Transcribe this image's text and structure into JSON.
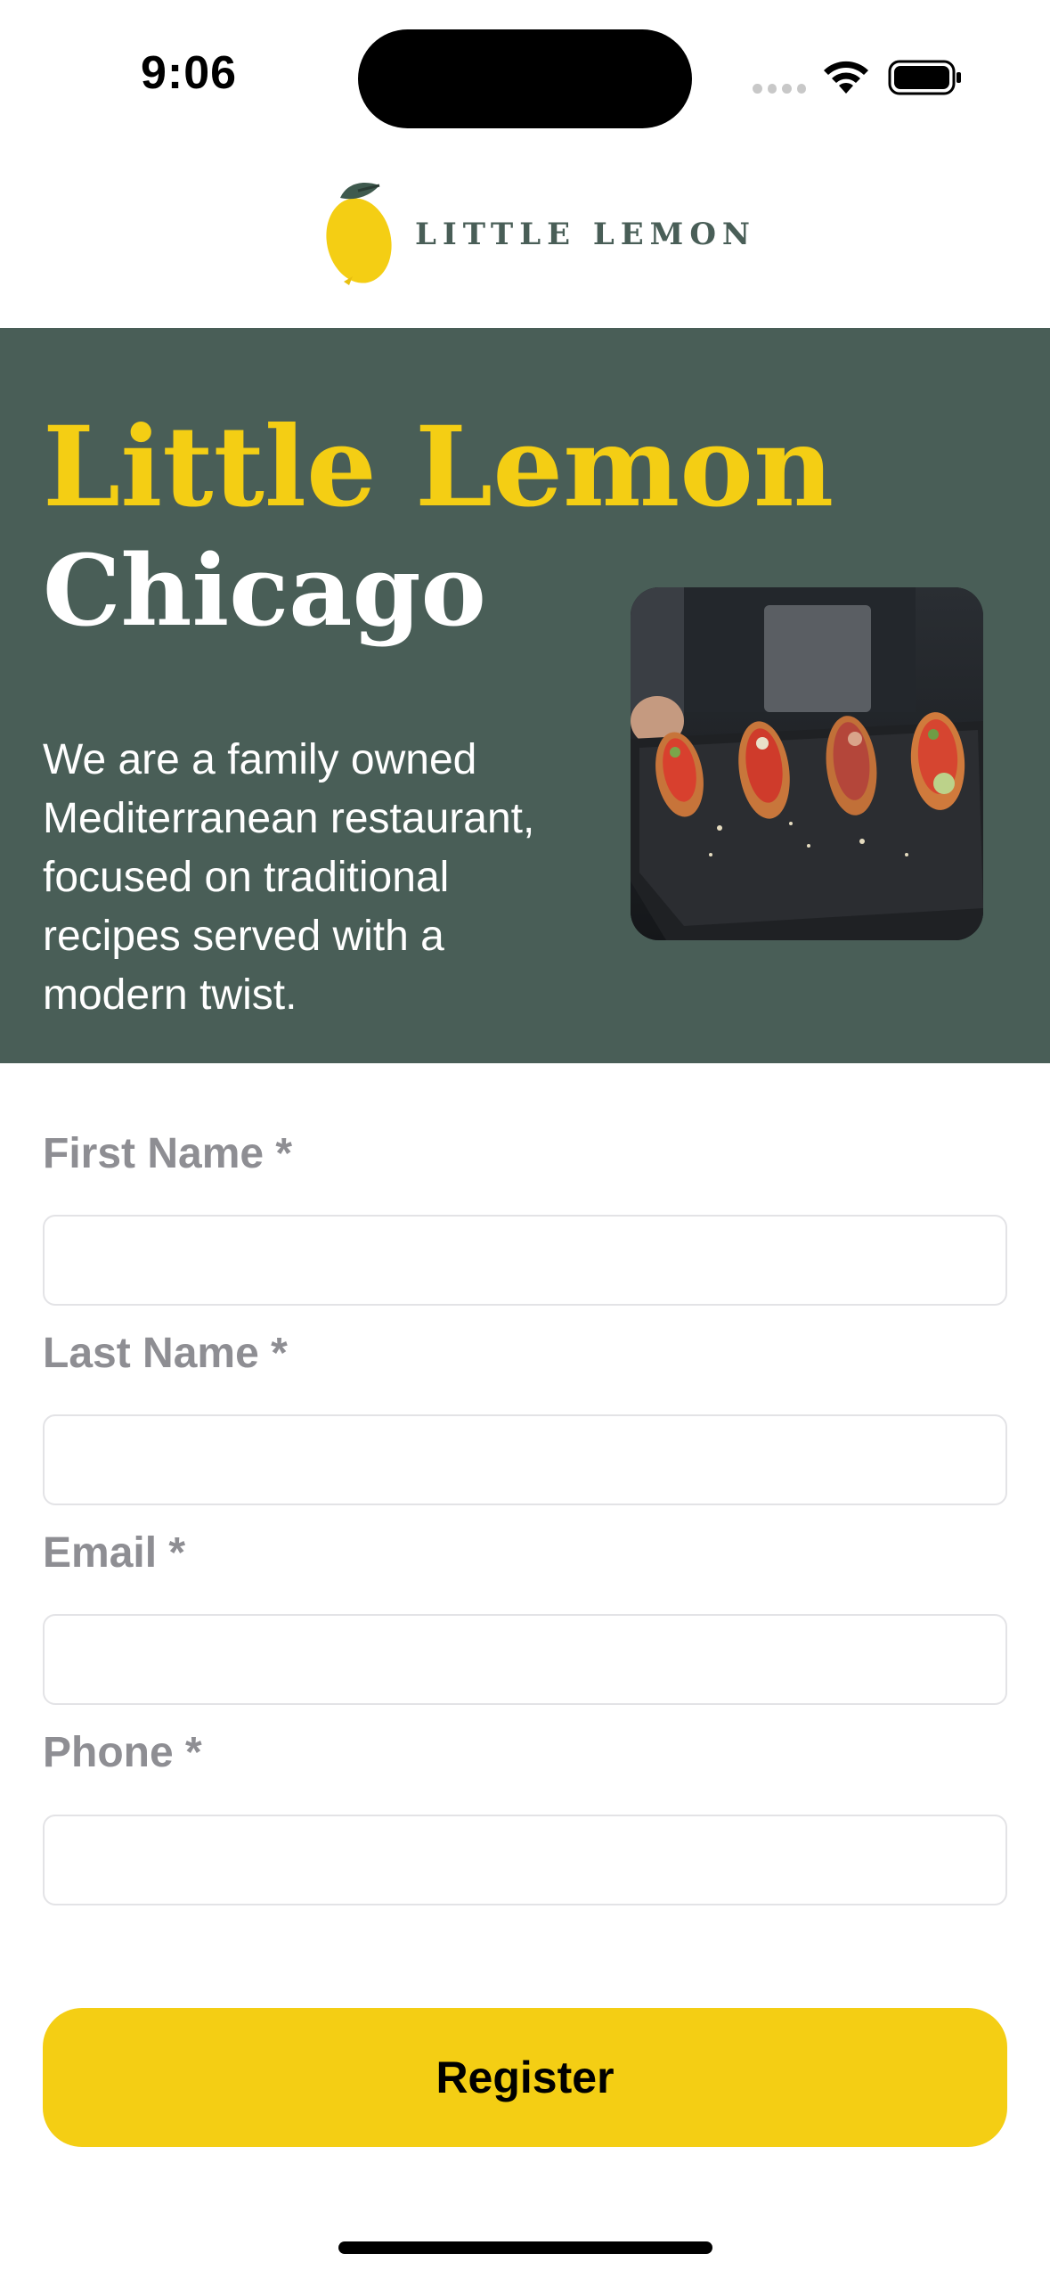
{
  "status_bar": {
    "time": "9:06"
  },
  "header": {
    "logo_text": "LITTLE LEMON",
    "logo_icon": "lemon-icon"
  },
  "hero": {
    "title": "Little Lemon",
    "subtitle": "Chicago",
    "description": "We are a family owned Mediterranean restaurant, focused on traditional recipes served with a modern twist.",
    "image": "bruschetta-plate-photo"
  },
  "form": {
    "fields": [
      {
        "label": "First Name *",
        "value": "",
        "placeholder": ""
      },
      {
        "label": "Last Name *",
        "value": "",
        "placeholder": ""
      },
      {
        "label": "Email *",
        "value": "",
        "placeholder": ""
      },
      {
        "label": "Phone *",
        "value": "",
        "placeholder": ""
      }
    ],
    "submit_label": "Register"
  },
  "colors": {
    "primary_green": "#495e57",
    "primary_yellow": "#f4ce14",
    "label_gray": "#8e8e93"
  }
}
